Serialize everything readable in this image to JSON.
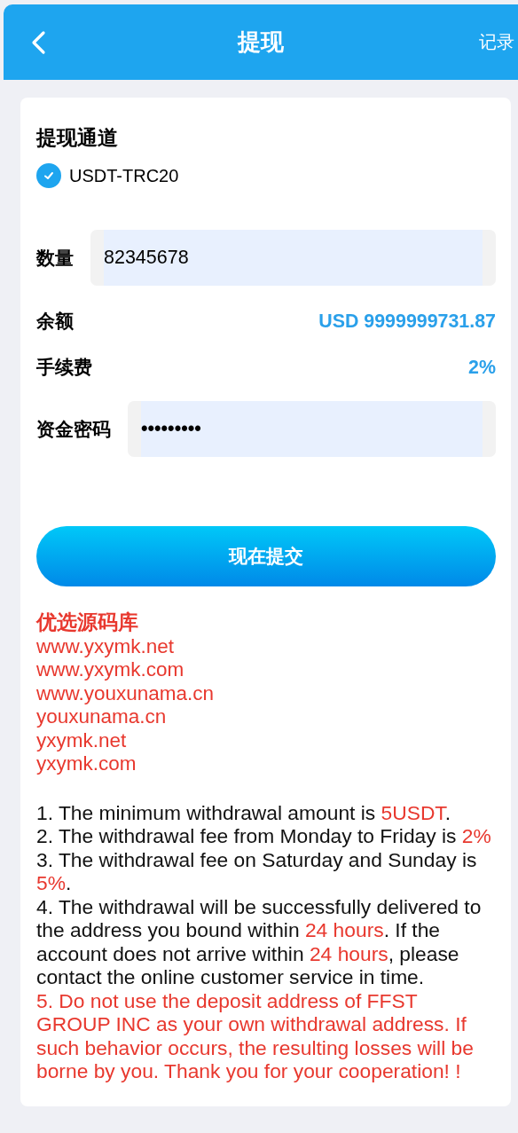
{
  "header": {
    "title": "提现",
    "record_link": "记录"
  },
  "channel": {
    "heading": "提现通道",
    "option": "USDT-TRC20",
    "checked": true
  },
  "form": {
    "amount": {
      "label": "数量",
      "value": "82345678"
    },
    "balance": {
      "label": "余额",
      "value": "USD 9999999731.87"
    },
    "fee": {
      "label": "手续费",
      "value": "2%"
    },
    "password": {
      "label": "资金密码",
      "value": "•••••••••"
    }
  },
  "submit_button": "现在提交",
  "promo": {
    "title": "优选源码库",
    "sites": [
      "www.yxymk.net",
      "www.yxymk.com",
      "www.youxunama.cn",
      "youxunama.cn",
      "yxymk.net",
      "yxymk.com"
    ]
  },
  "notes": [
    {
      "parts": [
        {
          "text": "1. The minimum withdrawal amount is ",
          "highlight": false
        },
        {
          "text": "5USDT",
          "highlight": true
        },
        {
          "text": ".",
          "highlight": false
        }
      ]
    },
    {
      "parts": [
        {
          "text": "2. The withdrawal fee from Monday to Friday is ",
          "highlight": false
        },
        {
          "text": "2%",
          "highlight": true
        }
      ]
    },
    {
      "parts": [
        {
          "text": "3. The withdrawal fee on Saturday and Sunday is ",
          "highlight": false
        },
        {
          "text": "5%",
          "highlight": true
        },
        {
          "text": ".",
          "highlight": false
        }
      ]
    },
    {
      "parts": [
        {
          "text": "4. The withdrawal will be successfully delivered to the address you bound within ",
          "highlight": false
        },
        {
          "text": "24 hours",
          "highlight": true
        },
        {
          "text": ". If the account does not arrive within ",
          "highlight": false
        },
        {
          "text": "24 hours",
          "highlight": true
        },
        {
          "text": ", please contact the online customer service in time.",
          "highlight": false
        }
      ]
    },
    {
      "parts": [
        {
          "text": "5. Do not use the deposit address of FFST GROUP INC as your own withdrawal address. If such behavior occurs, the resulting losses will be borne by you. Thank you for your cooperation! !",
          "highlight": true
        }
      ]
    }
  ]
}
